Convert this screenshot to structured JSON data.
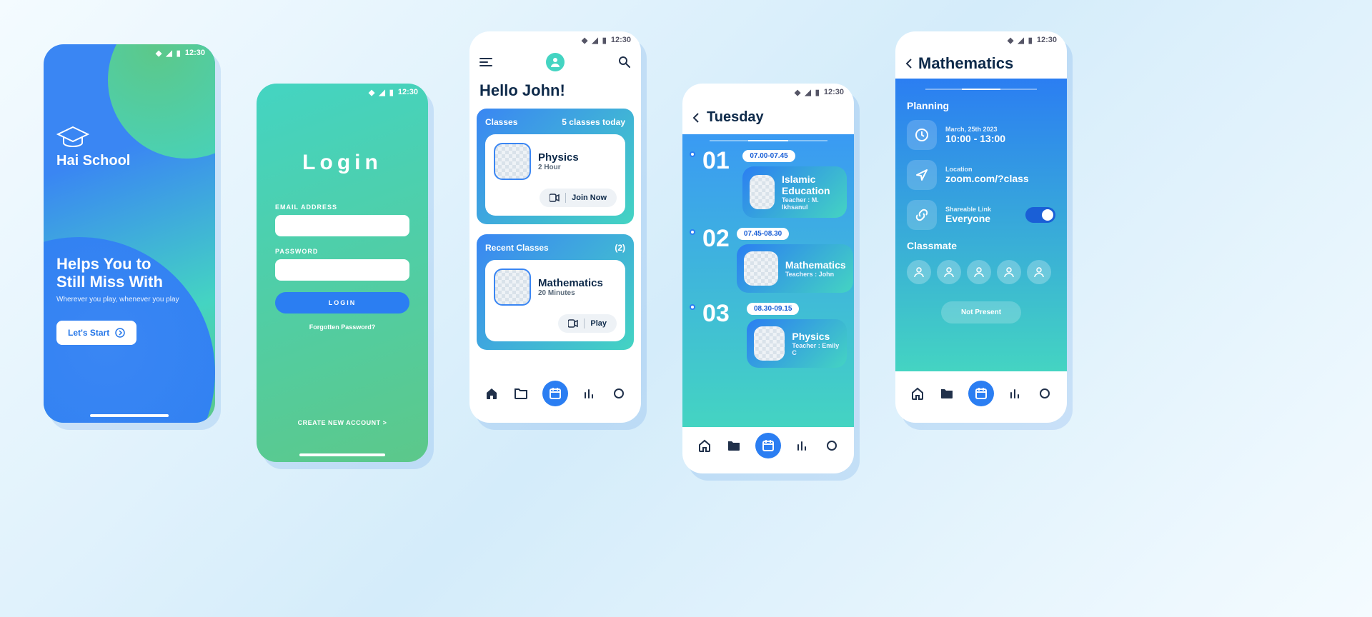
{
  "status_time": "12:30",
  "hero": {
    "brand": "Hai School",
    "headline_l1": "Helps You to",
    "headline_l2": "Still Miss With",
    "sub": "Wherever you play, whenever you play",
    "cta": "Let's Start"
  },
  "login": {
    "title": "Login",
    "email_label": "EMAIL ADDRESS",
    "password_label": "PASSWORD",
    "button": "LOGIN",
    "forgot": "Forgotten Password?",
    "create": "CREATE NEW ACCOUNT >"
  },
  "home": {
    "greeting": "Hello John!",
    "classes_header": "Classes",
    "classes_count": "5 classes today",
    "class": {
      "title": "Physics",
      "meta": "2 Hour",
      "action": "Join Now"
    },
    "recent_header": "Recent Classes",
    "recent_count": "(2)",
    "recent": {
      "title": "Mathematics",
      "meta": "20 Minutes",
      "action": "Play"
    }
  },
  "schedule": {
    "day": "Tuesday",
    "items": [
      {
        "num": "01",
        "time": "07.00-07.45",
        "title": "Islamic Education",
        "meta": "Teacher : M. Ikhsanul"
      },
      {
        "num": "02",
        "time": "07.45-08.30",
        "title": "Mathematics",
        "meta": "Teachers : John"
      },
      {
        "num": "03",
        "time": "08.30-09.15",
        "title": "Physics",
        "meta": "Teacher : Emily C"
      }
    ]
  },
  "detail": {
    "title": "Mathematics",
    "section": "Planning",
    "date_label": "March, 25th 2023",
    "date_value": "10:00 - 13:00",
    "loc_label": "Location",
    "loc_value": "zoom.com/?class",
    "share_label": "Shareable Link",
    "share_value": "Everyone",
    "classmate": "Classmate",
    "not_present": "Not Present"
  }
}
